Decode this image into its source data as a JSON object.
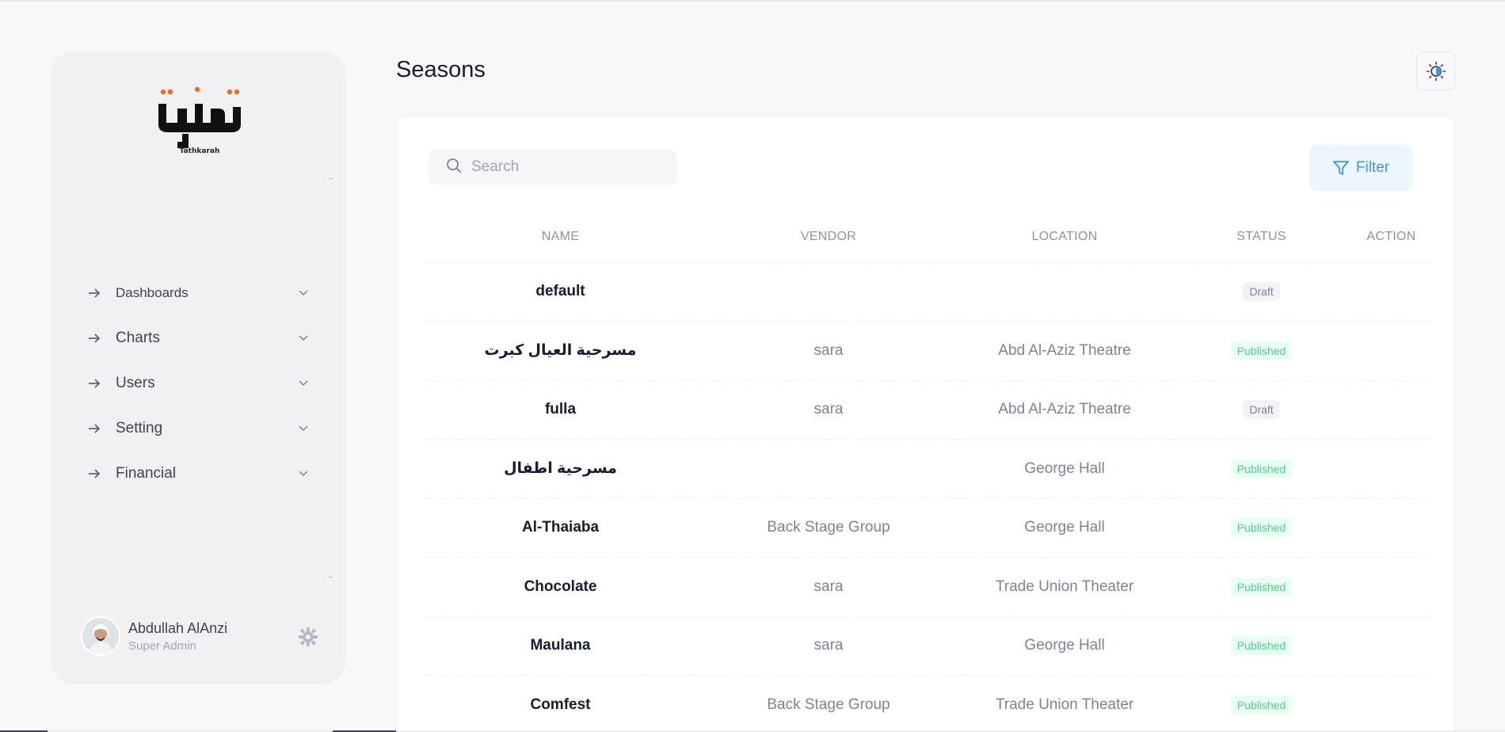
{
  "sidebar": {
    "logo_text": "تذكرة",
    "logo_sub": "Tathkarah",
    "nav": [
      {
        "label": "Dashboards"
      },
      {
        "label": "Charts"
      },
      {
        "label": "Users"
      },
      {
        "label": "Setting"
      },
      {
        "label": "Financial"
      }
    ],
    "user": {
      "name": "Abdullah AlAnzi",
      "role": "Super Admin"
    }
  },
  "header": {
    "title": "Seasons"
  },
  "toolbar": {
    "search_placeholder": "Search",
    "filter_label": "Filter"
  },
  "table": {
    "columns": [
      "NAME",
      "VENDOR",
      "LOCATION",
      "STATUS",
      "ACTION"
    ],
    "rows": [
      {
        "name": "default",
        "vendor": "",
        "location": "",
        "status": "Draft"
      },
      {
        "name": "مسرحية العيال كبرت",
        "vendor": "sara",
        "location": "Abd Al-Aziz Theatre",
        "status": "Published"
      },
      {
        "name": "fulla",
        "vendor": "sara",
        "location": "Abd Al-Aziz Theatre",
        "status": "Draft"
      },
      {
        "name": "مسرحية اطفال",
        "vendor": "",
        "location": "George Hall",
        "status": "Published"
      },
      {
        "name": "Al-Thaiaba",
        "vendor": "Back Stage Group",
        "location": "George Hall",
        "status": "Published"
      },
      {
        "name": "Chocolate",
        "vendor": "sara",
        "location": "Trade Union Theater",
        "status": "Published"
      },
      {
        "name": "Maulana",
        "vendor": "sara",
        "location": "George Hall",
        "status": "Published"
      },
      {
        "name": "Comfest",
        "vendor": "Back Stage Group",
        "location": "Trade Union Theater",
        "status": "Published"
      }
    ]
  },
  "colors": {
    "accent": "#3e97e4",
    "logo_dot": "#f26b1d",
    "published": "#50cd89",
    "draft": "#7e8299"
  }
}
